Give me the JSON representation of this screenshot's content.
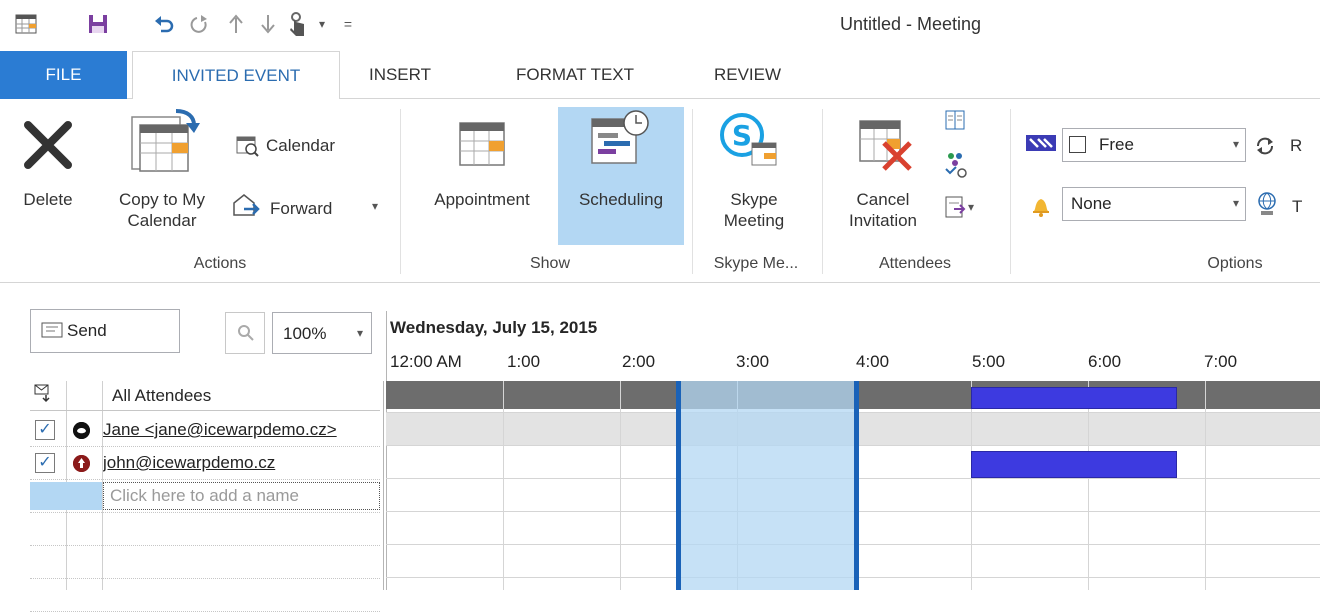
{
  "window": {
    "title": "Untitled - Meeting"
  },
  "qat": {
    "more_glyph": "▾",
    "customize_glyph": "="
  },
  "tabs": [
    {
      "label": "FILE"
    },
    {
      "label": "INVITED EVENT"
    },
    {
      "label": "INSERT"
    },
    {
      "label": "FORMAT TEXT"
    },
    {
      "label": "REVIEW"
    }
  ],
  "ribbon": {
    "actions": {
      "delete": "Delete",
      "copy_line1": "Copy to My",
      "copy_line2": "Calendar",
      "calendar": "Calendar",
      "forward": "Forward",
      "group": "Actions"
    },
    "show": {
      "appointment": "Appointment",
      "scheduling": "Scheduling",
      "group": "Show"
    },
    "skype": {
      "line1": "Skype",
      "line2": "Meeting",
      "group": "Skype Me..."
    },
    "attendees": {
      "cancel_line1": "Cancel",
      "cancel_line2": "Invitation",
      "group": "Attendees"
    },
    "options": {
      "show_as": "Free",
      "reminder": "None",
      "r_clipped": "R",
      "t_clipped": "T",
      "group": "Options"
    }
  },
  "scheduling": {
    "send": "Send",
    "zoom": "100%",
    "date": "Wednesday, July 15, 2015",
    "hours": [
      "12:00 AM",
      "1:00",
      "2:00",
      "3:00",
      "4:00",
      "5:00",
      "6:00",
      "7:00"
    ],
    "all_attendees": "All Attendees",
    "attendees": [
      {
        "name": "Jane <jane@icewarpdemo.cz>",
        "checked": true,
        "icon": "organizer-icon"
      },
      {
        "name": "john@icewarpdemo.cz",
        "checked": true,
        "icon": "required-attendee-icon"
      }
    ],
    "add_placeholder": "Click here to add a name"
  },
  "colors": {
    "accent": "#2b7cd3",
    "selected_ribbon": "#b3d7f3",
    "busy": "#3d3ae0",
    "meeting_block": "#cde4f7",
    "meeting_border": "#1a62b8"
  }
}
